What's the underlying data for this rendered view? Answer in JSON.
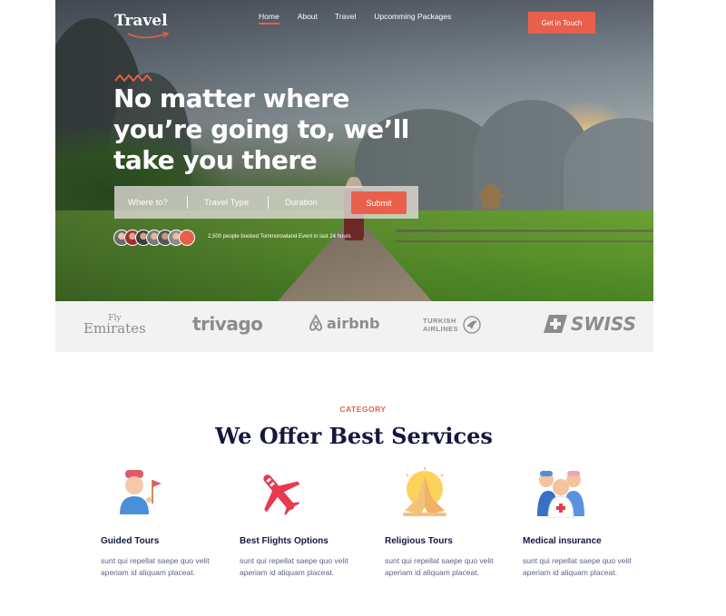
{
  "brand": {
    "name": "Travel"
  },
  "nav": {
    "items": [
      "Home",
      "About",
      "Travel",
      "Upcomming Packages"
    ],
    "active": "Home"
  },
  "cta": {
    "label": "Get in Touch"
  },
  "hero": {
    "headline": "No matter where you’re going to, we’ll take you there",
    "search": {
      "where_placeholder": "Where to?",
      "type_placeholder": "Travel Type",
      "duration_placeholder": "Duration",
      "submit_label": "Submit"
    },
    "booked_text": "2,500 people booked Tommorowland Event in last 24 hours"
  },
  "partners": {
    "emirates_top": "Fly",
    "emirates_bottom": "Emirates",
    "trivago": "trivago",
    "airbnb": "airbnb",
    "turkish_top": "TURKISH",
    "turkish_bottom": "AIRLINES",
    "swiss": "SWISS"
  },
  "services": {
    "category": "CATEGORY",
    "title": "We Offer Best Services",
    "items": [
      {
        "title": "Guided Tours",
        "desc": "sunt qui repellat saepe quo velit aperiam id aliquam placeat.",
        "icon": "tour-guide-icon"
      },
      {
        "title": "Best Flights Options",
        "desc": "sunt qui repellat saepe quo velit aperiam id aliquam placeat.",
        "icon": "airplane-icon"
      },
      {
        "title": "Religious Tours",
        "desc": "sunt qui repellat saepe quo velit aperiam id aliquam placeat.",
        "icon": "praying-hands-icon"
      },
      {
        "title": "Medical insurance",
        "desc": "sunt qui repellat saepe quo velit aperiam id aliquam placeat.",
        "icon": "medical-team-icon"
      }
    ]
  },
  "colors": {
    "accent": "#e8604c",
    "heading": "#14183e",
    "body_text": "#5e6282",
    "partners_bg": "#f2f2f2"
  }
}
